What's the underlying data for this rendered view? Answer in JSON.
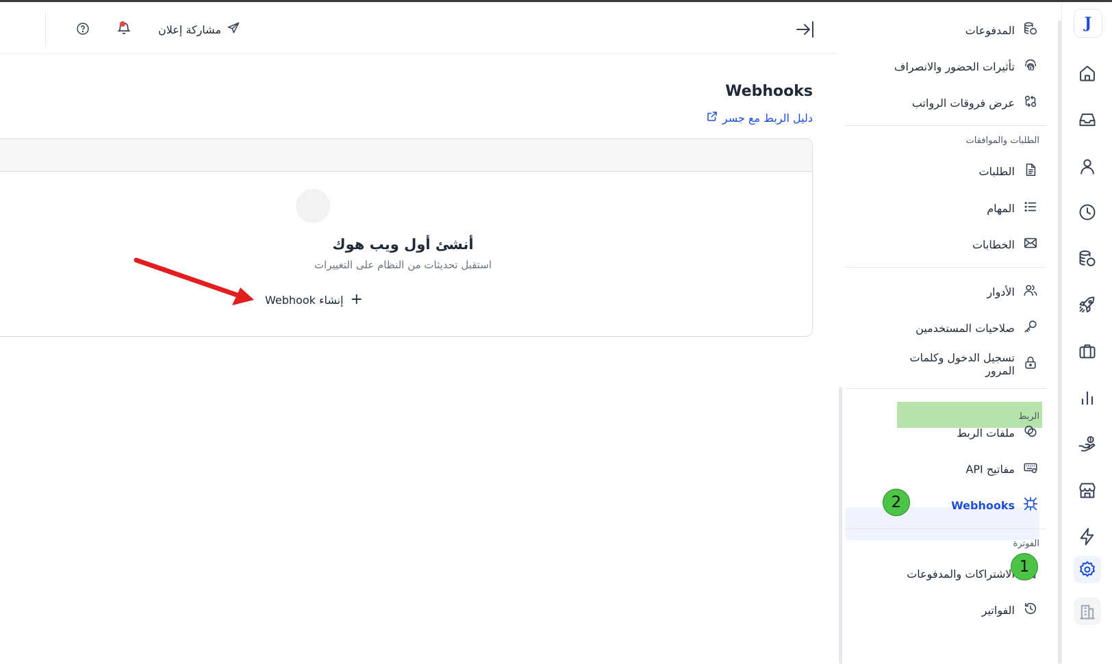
{
  "header": {
    "share_label": "مشاركة إعلان"
  },
  "page": {
    "title": "Webhooks",
    "guide_link": "دليل الربط مع جسر"
  },
  "empty_state": {
    "title": "أنشئ أول ويب هوك",
    "subtitle": "استقبل تحديثات من النظام على التغييرات",
    "create_label": "إنشاء Webhook"
  },
  "sidebar": {
    "items_top": [
      {
        "label": "المدفوعات",
        "icon": "coins-icon"
      },
      {
        "label": "تأثيرات الحضور والانصراف",
        "icon": "fingerprint-icon"
      },
      {
        "label": "عرض فروقات الرواتب",
        "icon": "compare-icon"
      }
    ],
    "section_requests": "الطلبات والموافقات",
    "items_requests": [
      {
        "label": "الطلبات",
        "icon": "document-icon"
      },
      {
        "label": "المهام",
        "icon": "list-icon"
      },
      {
        "label": "الخطابات",
        "icon": "mail-icon"
      }
    ],
    "items_access": [
      {
        "label": "الأدوار",
        "icon": "users-icon"
      },
      {
        "label": "صلاحيات المستخدمين",
        "icon": "key-icon"
      },
      {
        "label": "تسجيل الدخول وكلمات المرور",
        "icon": "lock-icon"
      }
    ],
    "section_integration": "الربط",
    "items_integration": [
      {
        "label": "ملفات الربط",
        "icon": "link-circles-icon"
      },
      {
        "label": "مفاتيح API",
        "icon": "keyboard-icon"
      },
      {
        "label": "Webhooks",
        "icon": "webhook-icon",
        "active": true
      }
    ],
    "section_billing": "الفوترة",
    "items_billing": [
      {
        "label": "الاشتراكات والمدفوعات",
        "icon": "book-icon"
      },
      {
        "label": "الفواتير",
        "icon": "history-icon"
      }
    ]
  },
  "rail": {
    "logo_letter": "J",
    "items": [
      "home-icon",
      "inbox-icon",
      "user-icon",
      "clock-icon",
      "coins-icon",
      "rocket-icon",
      "briefcase-icon",
      "chart-icon",
      "hand-coins-icon",
      "store-icon",
      "bolt-icon",
      "settings-icon",
      "building-icon"
    ]
  },
  "annotations": {
    "badge_1": "1",
    "badge_2": "2"
  },
  "colors": {
    "accent": "#1d4ed8",
    "active_bg": "#eef3fd",
    "section_highlight": "#b5e3a9",
    "badge_green": "#4cc445",
    "arrow_red": "#e11d1d",
    "notification_dot": "#ef4444"
  }
}
